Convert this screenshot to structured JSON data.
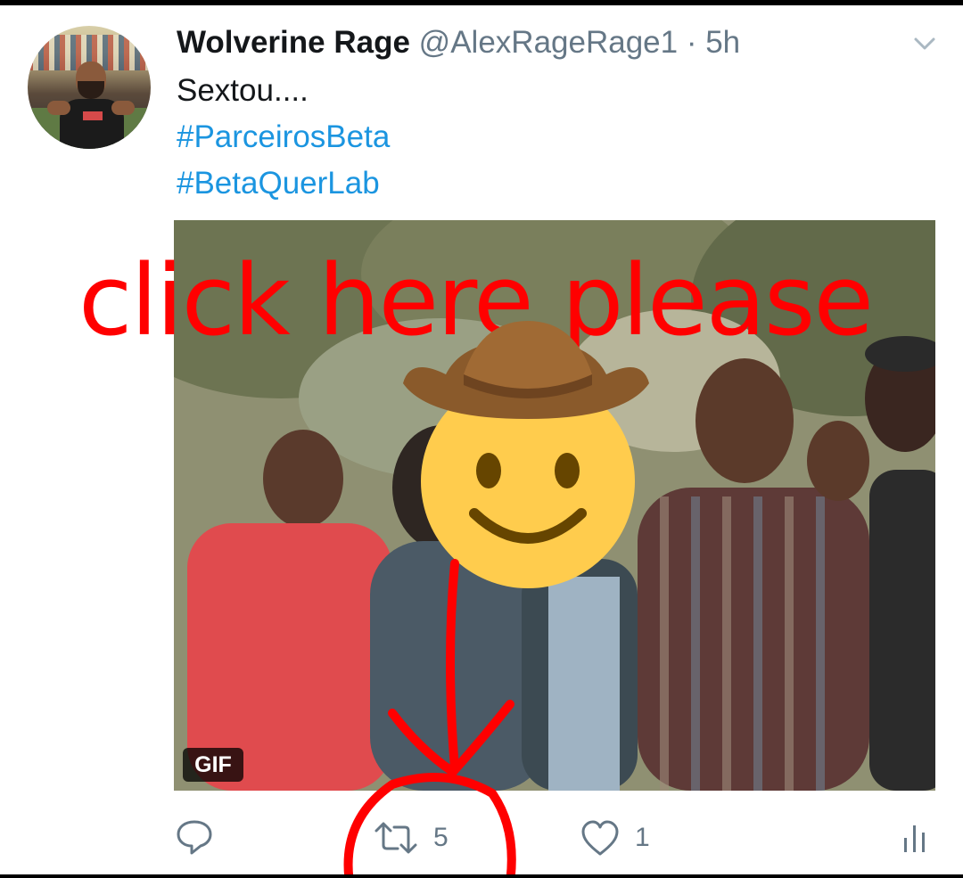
{
  "tweet": {
    "user_name": "Wolverine Rage",
    "user_handle": "@AlexRageRage1",
    "separator": " · ",
    "timestamp": "5h",
    "text": "Sextou....",
    "hashtags": [
      "#ParceirosBeta",
      "#BetaQuerLab"
    ]
  },
  "media": {
    "badge": "GIF"
  },
  "overlay": {
    "text": "click here please",
    "emoji": "cowboy-face-emoji",
    "color": "#ff0000"
  },
  "actions": {
    "reply_icon": "reply-icon",
    "retweet_icon": "retweet-icon",
    "retweet_count": "5",
    "like_icon": "heart-icon",
    "like_count": "1",
    "analytics_icon": "analytics-icon"
  },
  "colors": {
    "text": "#14171a",
    "secondary": "#657786",
    "hashtag": "#1b95e0"
  }
}
